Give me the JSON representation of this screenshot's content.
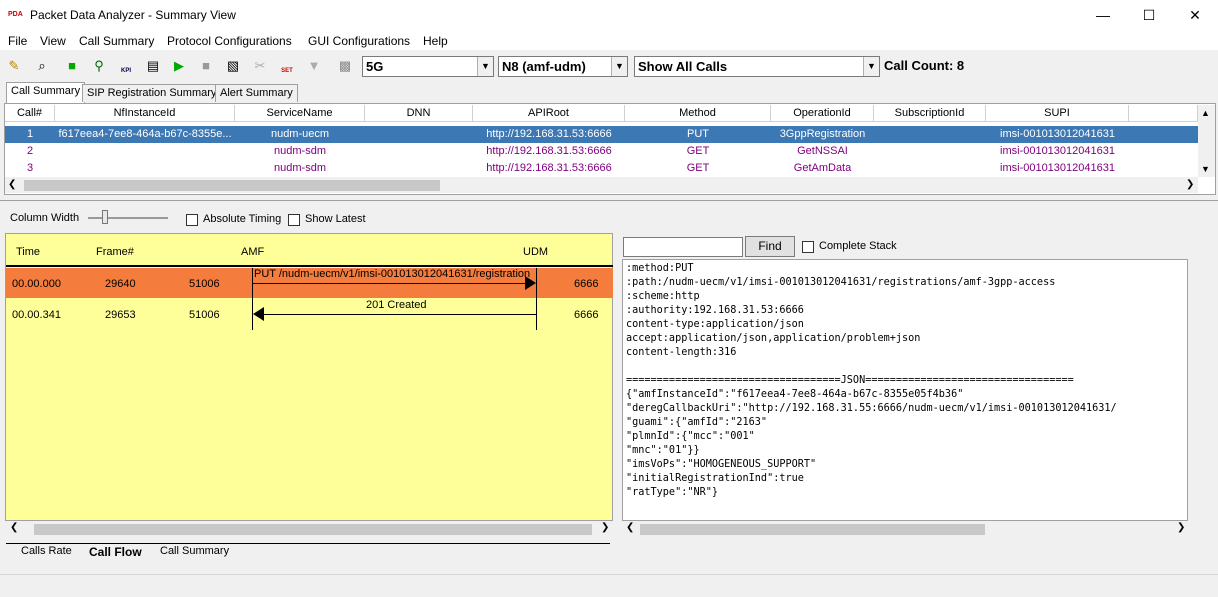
{
  "window": {
    "title": "Packet Data Analyzer - Summary View",
    "icon_label": "PDA"
  },
  "menu": [
    "File",
    "View",
    "Call Summary",
    "Protocol Configurations",
    "GUI Configurations",
    "Help"
  ],
  "toolbar": {
    "combo_network": "5G",
    "combo_interface": "N8 (amf-udm)",
    "combo_filter": "Show All Calls",
    "call_count": "Call Count: 8",
    "kpi_label": "KPI",
    "set_label": "SET"
  },
  "tabs": [
    "Call Summary",
    "SIP Registration Summary",
    "Alert Summary"
  ],
  "grid": {
    "headers": [
      "Call#",
      "NfInstanceId",
      "ServiceName",
      "DNN",
      "APIRoot",
      "Method",
      "OperationId",
      "SubscriptionId",
      "SUPI"
    ],
    "rows": [
      [
        "1",
        "f617eea4-7ee8-464a-b67c-8355e...",
        "nudm-uecm",
        "",
        "http://192.168.31.53:6666",
        "PUT",
        "3GppRegistration",
        "",
        "imsi-001013012041631"
      ],
      [
        "2",
        "",
        "nudm-sdm",
        "",
        "http://192.168.31.53:6666",
        "GET",
        "GetNSSAI",
        "",
        "imsi-001013012041631"
      ],
      [
        "3",
        "",
        "nudm-sdm",
        "",
        "http://192.168.31.53:6666",
        "GET",
        "GetAmData",
        "",
        "imsi-001013012041631"
      ]
    ]
  },
  "controls": {
    "column_width": "Column Width",
    "absolute_timing": "Absolute Timing",
    "show_latest": "Show Latest",
    "find": "Find",
    "complete_stack": "Complete Stack"
  },
  "flow": {
    "headers": {
      "time": "Time",
      "frame": "Frame#",
      "src": "AMF",
      "dst": "UDM"
    },
    "rows": [
      {
        "time": "00.00.000",
        "frame": "29640",
        "src_port": "51006",
        "dst_port": "6666",
        "label": "PUT /nudm-uecm/v1/imsi-001013012041631/registration"
      },
      {
        "time": "00.00.341",
        "frame": "29653",
        "src_port": "51006",
        "dst_port": "6666",
        "label": "201 Created"
      }
    ]
  },
  "detail_lines": [
    ":method:PUT",
    ":path:/nudm-uecm/v1/imsi-001013012041631/registrations/amf-3gpp-access",
    ":scheme:http",
    ":authority:192.168.31.53:6666",
    "content-type:application/json",
    "accept:application/json,application/problem+json",
    "content-length:316",
    "",
    "===================================JSON==================================",
    "{\"amfInstanceId\":\"f617eea4-7ee8-464a-b67c-8355e05f4b36\"",
    "\"deregCallbackUri\":\"http://192.168.31.55:6666/nudm-uecm/v1/imsi-001013012041631/",
    "\"guami\":{\"amfId\":\"2163\"",
    "\"plmnId\":{\"mcc\":\"001\"",
    "\"mnc\":\"01\"}}",
    "\"imsVoPs\":\"HOMOGENEOUS_SUPPORT\"",
    "\"initialRegistrationInd\":true",
    "\"ratType\":\"NR\"}"
  ],
  "bottom_tabs": [
    "Calls Rate",
    "Call Flow",
    "Call Summary"
  ],
  "colors": {
    "selection": "#3c78b4",
    "flow_bg": "#ffff99",
    "flow_highlight": "#f47c3c",
    "row_text": "#800080"
  }
}
